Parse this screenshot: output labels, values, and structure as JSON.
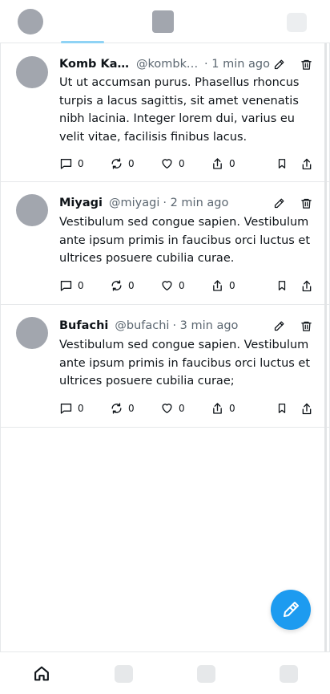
{
  "header": {
    "avatar_icon": "profile-avatar-placeholder",
    "logo_icon": "app-logo-placeholder",
    "right_icon": "settings-placeholder",
    "active_tab_color": "#8fd3f5"
  },
  "posts": [
    {
      "name": "Komb Kar...",
      "handle": "@kombka...",
      "time": "· 1 min ago",
      "text": "Ut ut accumsan purus. Phasellus rhoncus turpis a lacus sagittis, sit amet venenatis nibh lacinia. Integer lorem dui, varius eu velit vitae, facilisis finibus lacus.",
      "replies": "0",
      "reposts": "0",
      "likes": "0",
      "shares": "0"
    },
    {
      "name": "Miyagi",
      "handle": "@miyagi",
      "time": "· 2 min ago",
      "text": "Vestibulum sed congue sapien. Vestibulum ante ipsum primis in faucibus orci luctus et ultrices posuere cubilia curae.",
      "replies": "0",
      "reposts": "0",
      "likes": "0",
      "shares": "0"
    },
    {
      "name": "Bufachi",
      "handle": "@bufachi",
      "time": "· 3 min ago",
      "text": "Vestibulum sed congue sapien. Vestibulum ante ipsum primis in faucibus orci luctus et ultrices posuere cubilia curae;",
      "replies": "0",
      "reposts": "0",
      "likes": "0",
      "shares": "0"
    }
  ],
  "fab": {
    "icon": "compose-pencil-icon",
    "color": "#1d9bf0"
  },
  "bottom_nav": {
    "items": [
      "home-icon",
      "nav-placeholder",
      "nav-placeholder",
      "nav-placeholder"
    ]
  }
}
